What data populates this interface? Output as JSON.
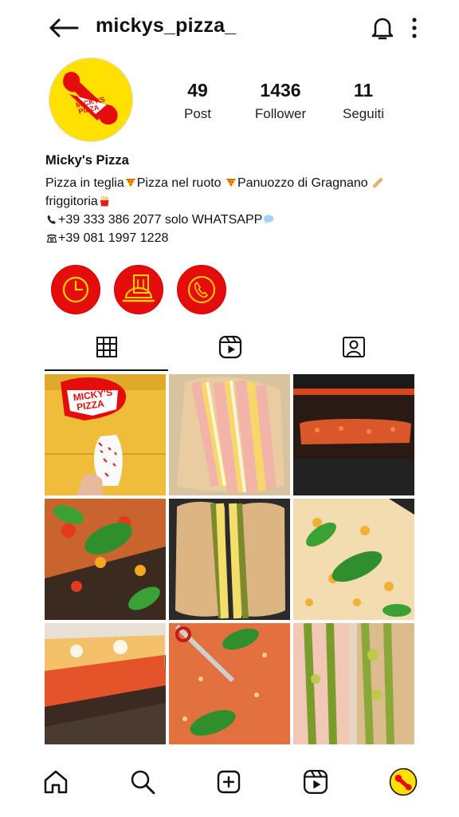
{
  "profile": {
    "username": "mickys_pizza_",
    "avatar_text": "MICKY'S PIZZA",
    "display_name": "Micky's Pizza",
    "bio": {
      "line1_a": "Pizza in teglia",
      "line1_b": "Pizza nel ruoto ",
      "line1_c": "Panuozzo di Gragnano ",
      "line2": "friggitoria",
      "line3": "+39 333 386 2077 solo WHATSAPP",
      "line4": "+39 081 1997 1228"
    }
  },
  "stats": [
    {
      "value": "49",
      "label": "Post"
    },
    {
      "value": "1436",
      "label": "Follower"
    },
    {
      "value": "11",
      "label": "Seguiti"
    }
  ],
  "highlights": [
    {
      "icon": "clock-icon"
    },
    {
      "icon": "delivery-menu-icon"
    },
    {
      "icon": "phone-icon"
    }
  ],
  "tabs": [
    {
      "icon": "grid-icon",
      "active": true
    },
    {
      "icon": "reels-icon",
      "active": false
    },
    {
      "icon": "tagged-icon",
      "active": false
    }
  ],
  "posts": [
    {
      "sign_text": "MICKY'S PIZZA",
      "desc": "pizza cone sign"
    },
    {
      "desc": "panuozzo ham cheese"
    },
    {
      "desc": "pizza oven"
    },
    {
      "desc": "pizza in teglia basil tomatoes"
    },
    {
      "desc": "panuozzo pesto"
    },
    {
      "desc": "pizza with basil and corn"
    },
    {
      "desc": "pizza slice"
    },
    {
      "desc": "cutting pizza with scissors"
    },
    {
      "desc": "panuozzo zucchini"
    }
  ],
  "bottom_nav": [
    {
      "icon": "home-icon"
    },
    {
      "icon": "search-icon"
    },
    {
      "icon": "add-post-icon"
    },
    {
      "icon": "reels-icon"
    },
    {
      "icon": "profile-avatar-icon"
    }
  ],
  "colors": {
    "brand_yellow": "#ffe000",
    "brand_red": "#e50c0c"
  }
}
